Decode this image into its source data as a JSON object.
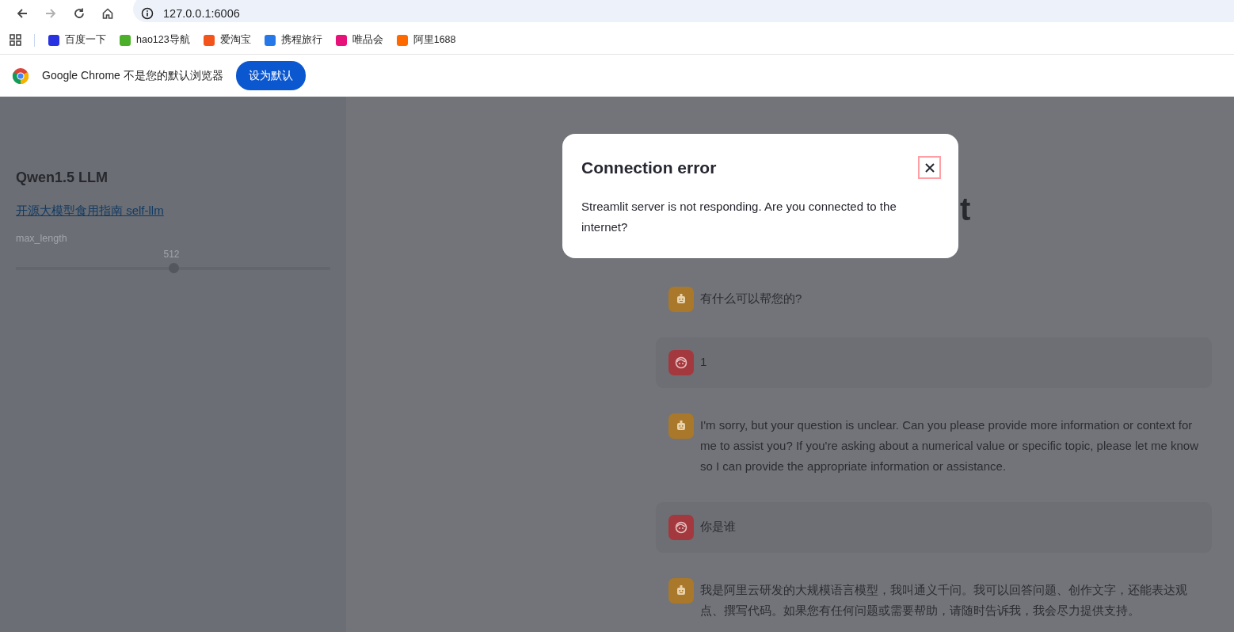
{
  "browser": {
    "address": "127.0.0.1:6006"
  },
  "bookmarks": [
    {
      "label": "百度一下",
      "color": "#2932e1"
    },
    {
      "label": "hao123导航",
      "color": "#4caf2a"
    },
    {
      "label": "爱淘宝",
      "color": "#f2541b"
    },
    {
      "label": "携程旅行",
      "color": "#2677e8"
    },
    {
      "label": "唯品会",
      "color": "#e6127a"
    },
    {
      "label": "阿里1688",
      "color": "#ff6a00"
    }
  ],
  "infobar": {
    "message": "Google Chrome 不是您的默认浏览器",
    "button": "设为默认"
  },
  "sidebar": {
    "title": "Qwen1.5 LLM",
    "link": "开源大模型食用指南 self-llm",
    "slider": {
      "label": "max_length",
      "reading": "512",
      "level": 0.5
    }
  },
  "main": {
    "title_fragment": "t"
  },
  "messages": [
    {
      "kind": "assistant",
      "text": "有什么可以帮您的?"
    },
    {
      "kind": "user",
      "text": "1"
    },
    {
      "kind": "assistant",
      "text": "I'm sorry, but your question is unclear. Can you please provide more information or context for me to assist you? If you're asking about a numerical value or specific topic, please let me know so I can provide the appropriate information or assistance."
    },
    {
      "kind": "user",
      "text": "你是谁"
    },
    {
      "kind": "assistant",
      "text": "我是阿里云研发的大规模语言模型，我叫通义千问。我可以回答问题、创作文字，还能表达观点、撰写代码。如果您有任何问题或需要帮助，请随时告诉我，我会尽力提供支持。"
    }
  ],
  "dialog": {
    "title": "Connection error",
    "message": "Streamlit server is not responding. Are you connected to the internet?"
  }
}
